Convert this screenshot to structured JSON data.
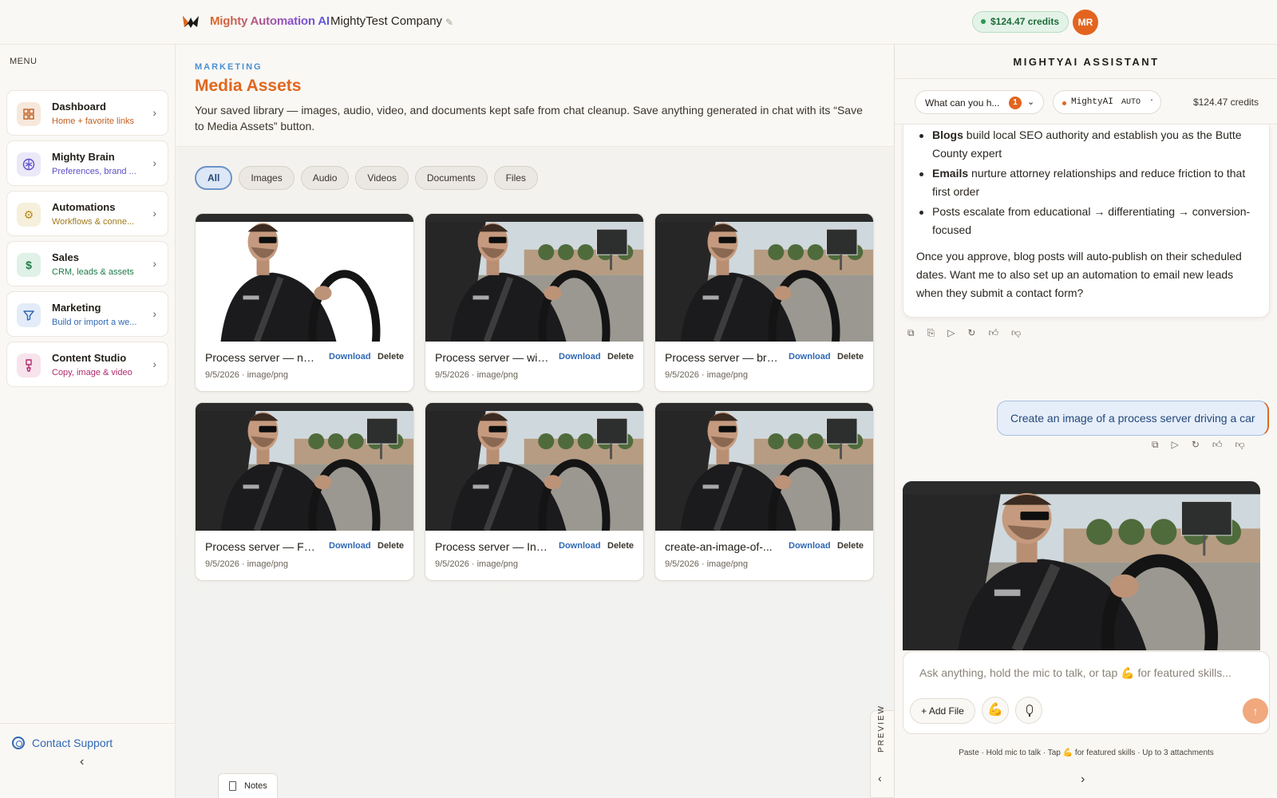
{
  "topbar": {
    "brand": "Mighty Automation AI",
    "company": "MightyTest Company",
    "credits": "$124.47 credits",
    "avatar_initials": "MR"
  },
  "sidebar": {
    "menu_title": "MENU",
    "items": [
      {
        "label": "Dashboard",
        "sub": "Home + favorite links",
        "icon": "dashboard-grid-icon",
        "accent": "#c0601f"
      },
      {
        "label": "Mighty Brain",
        "sub": "Preferences, brand ...",
        "icon": "brain-icon",
        "accent": "#5b4ec9"
      },
      {
        "label": "Automations",
        "sub": "Workflows & conne...",
        "icon": "gear-icon",
        "accent": "#b58a1f"
      },
      {
        "label": "Sales",
        "sub": "CRM, leads & assets",
        "icon": "dollar-icon",
        "accent": "#1f7a4a"
      },
      {
        "label": "Marketing",
        "sub": "Build or import a we...",
        "icon": "funnel-icon",
        "accent": "#2f68b4"
      },
      {
        "label": "Content Studio",
        "sub": "Copy, image & video",
        "icon": "brush-icon",
        "accent": "#b02a6e"
      }
    ],
    "contact_support": "Contact Support",
    "collapse_glyph": "‹"
  },
  "main": {
    "eyebrow": "MARKETING",
    "title": "Media Assets",
    "description": "Your saved library — images, audio, video, and documents kept safe from chat cleanup. Save anything generated in chat with its “Save to Media Assets” button.",
    "filters": [
      "All",
      "Images",
      "Audio",
      "Videos",
      "Documents",
      "Files"
    ],
    "active_filter": "All",
    "download_label": "Download",
    "delete_label": "Delete",
    "assets": [
      {
        "name": "Process server — no ...",
        "date": "9/5/2026",
        "type": "image/png"
      },
      {
        "name": "Process server — wit...",
        "date": "9/5/2026",
        "type": "image/png"
      },
      {
        "name": "Process server — brig...",
        "date": "9/5/2026",
        "type": "image/png"
      },
      {
        "name": "Process server — Fac...",
        "date": "9/5/2026",
        "type": "image/png"
      },
      {
        "name": "Process server — Inst...",
        "date": "9/5/2026",
        "type": "image/png"
      },
      {
        "name": "create-an-image-of-...",
        "date": "9/5/2026",
        "type": "image/png"
      }
    ],
    "notes_label": "Notes",
    "preview_label": "PREVIEW"
  },
  "assistant": {
    "title": "MIGHTYAI ASSISTANT",
    "ask_select": "What can you h...",
    "ask_badge": "1",
    "model_name": "MightyAI",
    "model_mode": "AUTO",
    "credits": "$124.47 credits",
    "message_bullets": [
      {
        "bold": "Blogs",
        "text": " build local SEO authority and establish you as the Butte County expert"
      },
      {
        "bold": "Emails",
        "text": " nurture attorney relationships and reduce friction to that first order"
      },
      {
        "bold": "",
        "text": "Posts escalate from educational → differentiating → conversion-focused"
      }
    ],
    "message_paragraph": "Once you approve, blog posts will auto-publish on their scheduled dates. Want me to also set up an automation to email new leads when they submit a contact form?",
    "user_message": "Create an image of a process server driving a car",
    "composer_placeholder": "Ask anything, hold the mic to talk, or tap 💪 for featured skills...",
    "add_file": "+ Add File",
    "hint": "Paste · Hold mic to talk · Tap 💪 for featured skills · Up to 3 attachments"
  }
}
